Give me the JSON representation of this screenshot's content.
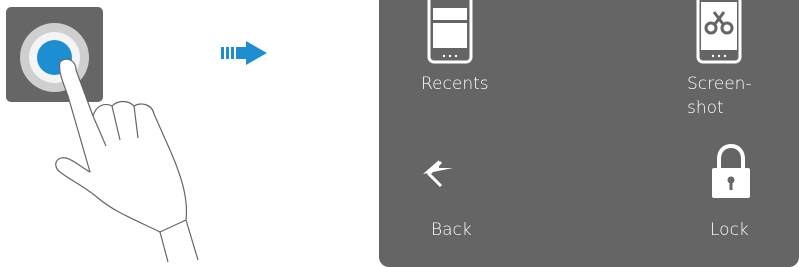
{
  "menu": {
    "items": [
      {
        "id": "recents",
        "label": "Recents",
        "icon": "recents-phone-icon"
      },
      {
        "id": "screenshot",
        "label": "Screen-\nshot",
        "icon": "screenshot-scissors-icon"
      },
      {
        "id": "back",
        "label": "Back",
        "icon": "back-arrow-icon"
      },
      {
        "id": "lock",
        "label": "Lock",
        "icon": "padlock-icon"
      }
    ]
  },
  "colors": {
    "panel": "#656565",
    "accent": "#1e8ed3",
    "tile": "#666666"
  }
}
